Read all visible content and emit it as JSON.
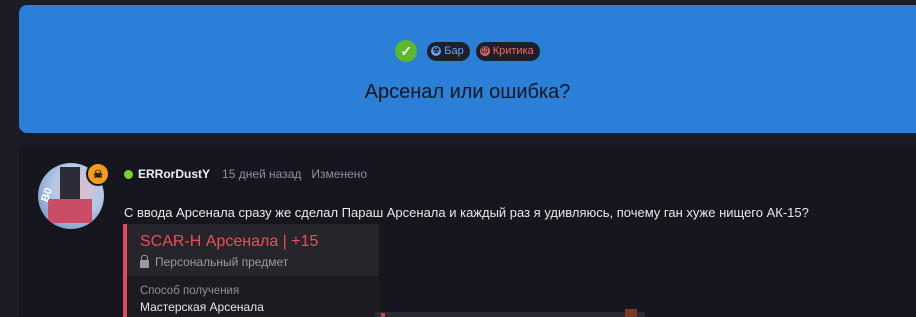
{
  "topic": {
    "title": "Арсенал или ошибка?",
    "solved_icon": "check-icon",
    "tags": [
      {
        "label": "Бар",
        "icon": "radiation-icon",
        "color": "#5fa8f5"
      },
      {
        "label": "Критика",
        "icon": "sad-face-icon",
        "color": "#f06a6a"
      }
    ],
    "header_color": "#2c7fd6"
  },
  "post": {
    "author": "ERRorDustY",
    "time": "15 дней назад",
    "edited": "Изменено",
    "avatar_sticker": "B0",
    "badge_icon": "skull-icon",
    "text": "С ввода Арсенала сразу же сделал Параш Арсенала и каждый раз я удивляюсь, почему ган хуже нищего АК-15?"
  },
  "item_card": {
    "name": "SCAR-H Арсенала | +15",
    "subtitle": "Персональный предмет",
    "obtain_label": "Способ получения",
    "obtain_value": "Мастерская Арсенала",
    "accent": "#e24a56"
  }
}
